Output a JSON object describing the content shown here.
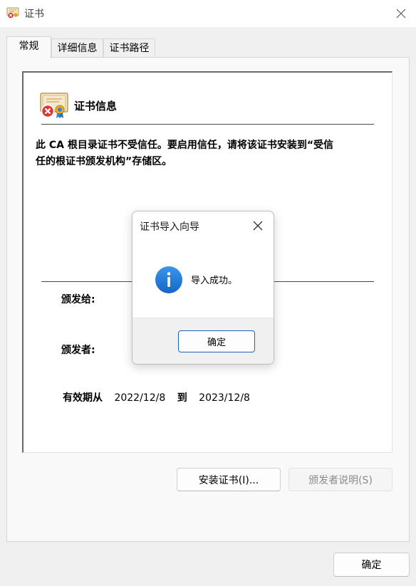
{
  "window": {
    "title": "证书",
    "close_icon": "close-icon"
  },
  "tabs": [
    {
      "label": "常规",
      "active": true
    },
    {
      "label": "详细信息",
      "active": false
    },
    {
      "label": "证书路径",
      "active": false
    }
  ],
  "general": {
    "section_title": "证书信息",
    "warning_line1": "此 CA 根目录证书不受信任。要启用信任，请将该证书安装到“受信",
    "warning_line2": "任的根证书颁发机构”存储区。",
    "issued_to_label": "颁发给:",
    "issued_by_label": "颁发者:",
    "validity_label": "有效期从",
    "valid_from": "2022/12/8",
    "to_label": "到",
    "valid_to": "2023/12/8"
  },
  "buttons": {
    "install": "安装证书(I)...",
    "issuer_statement": "颁发者说明(S)",
    "ok": "确定"
  },
  "dialog": {
    "title": "证书导入向导",
    "message": "导入成功。",
    "ok": "确定",
    "icon": "info-icon"
  },
  "colors": {
    "accent_blue": "#1c62b9",
    "info_icon_blue": "#1e78d4"
  }
}
